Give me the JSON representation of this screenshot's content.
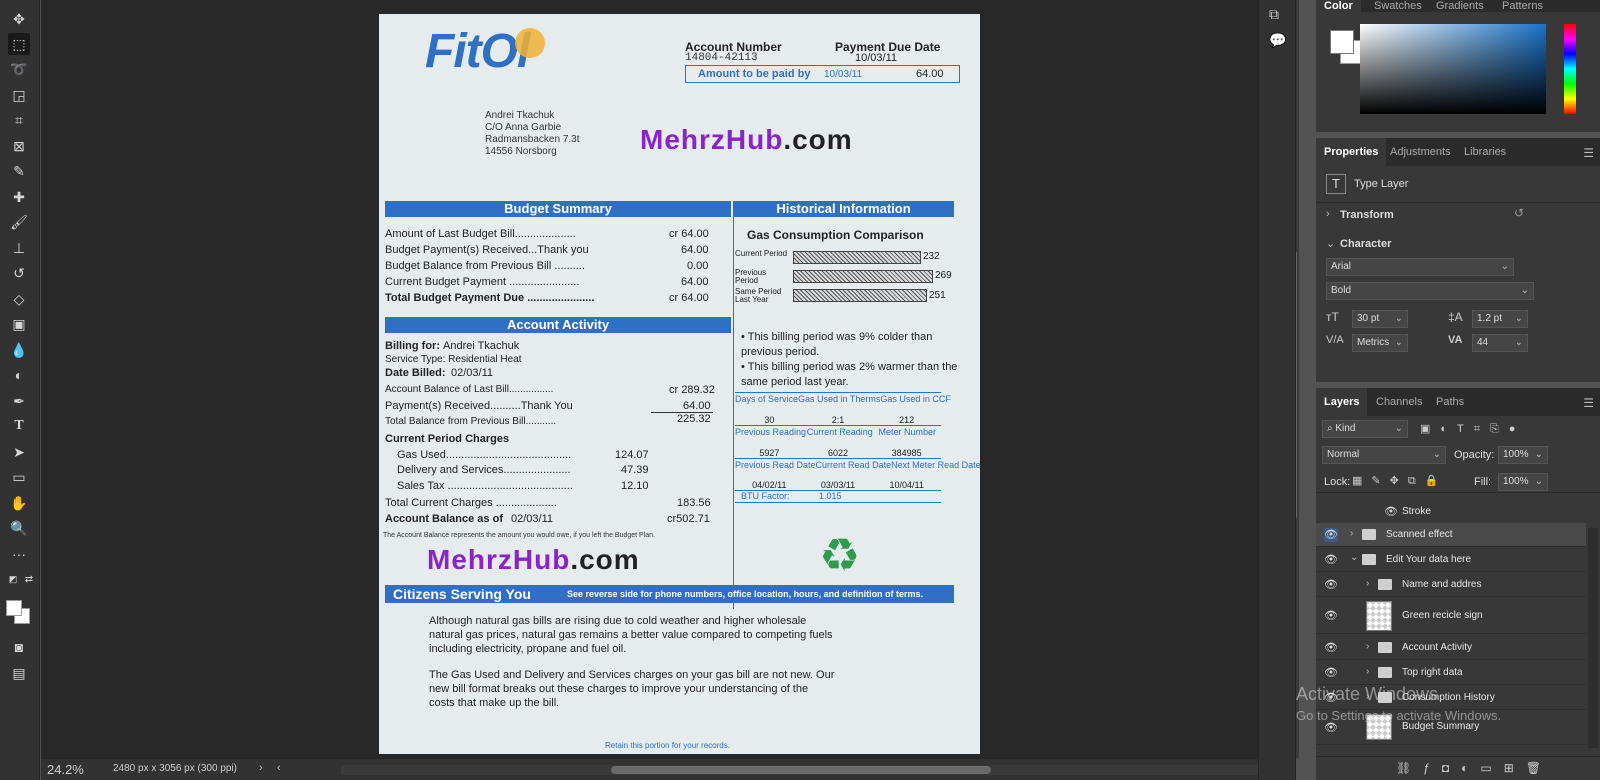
{
  "status": {
    "zoom": "24.2%",
    "doc_info": "2480 px x 3056 px (300 ppi)"
  },
  "toolbar": {
    "tools": [
      "move-icon",
      "marquee-icon",
      "lasso-icon",
      "object-select-icon",
      "crop-icon",
      "frame-icon",
      "eyedropper-icon",
      "healing-icon",
      "brush-icon",
      "stamp-icon",
      "history-brush-icon",
      "eraser-icon",
      "gradient-icon",
      "blur-icon",
      "dodge-icon",
      "pen-icon",
      "type-icon",
      "path-select-icon",
      "rectangle-icon",
      "hand-icon",
      "zoom-icon",
      "more-icon"
    ]
  },
  "doc": {
    "logo": "FitOl",
    "account_number_label": "Account Number",
    "account_number": "14804-42113",
    "payment_due_label": "Payment Due Date",
    "payment_due": "10/03/11",
    "amount_label": "Amount to be paid by",
    "amount_date": "10/03/11",
    "amount_value": "64.00",
    "address": [
      "Andrei Tkachuk",
      "C/O Anna Garbie",
      "Radmansbacken 7.3t",
      "14556 Norsborg"
    ],
    "watermark_a": "MehrzHub",
    "watermark_b": ".com",
    "budget_summary_title": "Budget Summary",
    "historical_title": "Historical Information",
    "budget_rows": [
      {
        "label": "Amount of Last Budget Bill....................",
        "value": "cr 64.00"
      },
      {
        "label": "Budget Payment(s) Received...Thank you",
        "value": "64.00"
      },
      {
        "label": "Budget Balance from Previous Bill ..........",
        "value": "0.00"
      },
      {
        "label": "Current Budget Payment .......................",
        "value": "64.00"
      },
      {
        "label": "Total Budget Payment Due ......................",
        "value": "cr 64.00"
      }
    ],
    "gas_comparison_title": "Gas Consumption Comparison",
    "gas_bars": [
      {
        "label": "Current Period",
        "value": "232"
      },
      {
        "label": "Previous Period",
        "value": "269"
      },
      {
        "label": "Same Period Last Year",
        "value": "251"
      }
    ],
    "bullets": [
      "This billing period was 9% colder than previous period.",
      "This billing period was 2% warmer than the same period last year."
    ],
    "account_activity_title": "Account Activity",
    "billing_for_label": "Billing for:",
    "billing_for": "Andrei Tkachuk",
    "service_type": "Service Type: Residential Heat",
    "date_billed_label": "Date Billed:",
    "date_billed": "02/03/11",
    "activity_rows": [
      {
        "label": "Account Balance of Last Bill................",
        "value": "cr 289.32"
      },
      {
        "label": "Payment(s) Received..........Thank You",
        "value": "64.00"
      },
      {
        "label": "Total Balance from Previous Bill...........",
        "value": "225.32"
      }
    ],
    "current_charges_title": "Current Period Charges",
    "charges": [
      {
        "label": "Gas Used.........................................",
        "value": "124.07"
      },
      {
        "label": "Delivery and Services......................",
        "value": "47.39"
      },
      {
        "label": "Sales Tax .........................................",
        "value": "12.10"
      }
    ],
    "total_current_label": "Total Current Charges ....................",
    "total_current": "183.56",
    "balance_label": "Account Balance as of",
    "balance_date": "02/03/11",
    "balance_value": "cr502.71",
    "balance_note": "The Account Balance represents the amount you would owe, if you left the Budget Plan.",
    "meter_headers_1": [
      "Days of Service",
      "Gas Used in Therms",
      "Gas Used in CCF"
    ],
    "meter_values_1": [
      "30",
      "2:1",
      "212"
    ],
    "meter_headers_2": [
      "Previous Reading",
      "Current Reading",
      "Meter Number"
    ],
    "meter_values_2": [
      "5927",
      "6022",
      "384985"
    ],
    "meter_headers_3": [
      "Previous Read Date",
      "Current Read Date",
      "Next Meter Read Date"
    ],
    "meter_values_3": [
      "04/02/11",
      "03/03/11",
      "10/04/11"
    ],
    "btu_label": "BTU Factor:",
    "btu_value": "1.015",
    "citizens_title": "Citizens Serving You",
    "citizens_note": "See reverse side for phone numbers, office location, hours, and definition of terms.",
    "para1": [
      "Although natural gas bills are rising due to cold weather and higher wholesale",
      "natural gas prices, natural gas remains a better value compared to competing fuels",
      "including electricity, propane and fuel oil."
    ],
    "para2": [
      "The Gas Used and Delivery and Services charges on your gas bill are not new. Our",
      "new bill format breaks out these charges to improve your understancing of the",
      "costs that make up the bill."
    ],
    "footer": "Retain this portion for your records."
  },
  "color_panel": {
    "tabs": [
      "Color",
      "Swatches",
      "Gradients",
      "Patterns"
    ]
  },
  "properties": {
    "tabs": [
      "Properties",
      "Adjustments",
      "Libraries"
    ],
    "layer_type": "Type Layer",
    "transform": "Transform",
    "character": "Character",
    "font": "Arial",
    "style": "Bold",
    "size": "30 pt",
    "leading": "1.2 pt",
    "kerning": "Metrics",
    "tracking": "44"
  },
  "layers": {
    "tabs": [
      "Layers",
      "Channels",
      "Paths"
    ],
    "kind": "Kind",
    "blend": "Normal",
    "opacity_label": "Opacity:",
    "opacity": "100%",
    "lock_label": "Lock:",
    "fill_label": "Fill:",
    "fill": "100%",
    "items": [
      {
        "name": "Stroke",
        "type": "effect"
      },
      {
        "name": "Scanned effect",
        "type": "folder"
      },
      {
        "name": "Edit Your data here",
        "type": "folder-open"
      },
      {
        "name": "Name and addres",
        "type": "folder"
      },
      {
        "name": "Green recicle sign",
        "type": "pixel"
      },
      {
        "name": "Account Activity",
        "type": "folder"
      },
      {
        "name": "Top right data",
        "type": "folder"
      },
      {
        "name": "Consumption History",
        "type": "folder"
      },
      {
        "name": "Budget Summary",
        "type": "pixel"
      }
    ]
  },
  "os_watermark": {
    "line1": "Activate Windows",
    "line2": "Go to Settings to activate Windows."
  }
}
